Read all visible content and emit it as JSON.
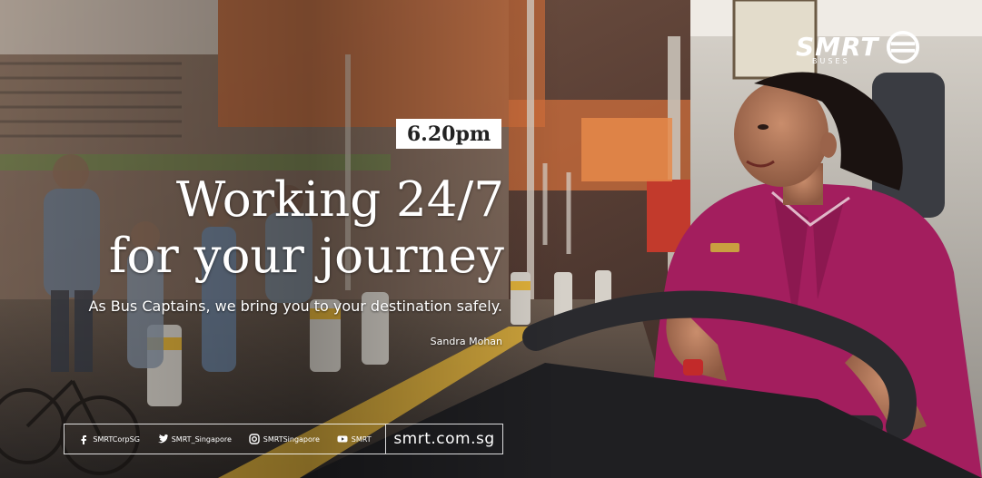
{
  "brand": {
    "logo_text": "SMRT",
    "logo_sub": "BUSES"
  },
  "time_badge": "6.20pm",
  "headline": {
    "line1": "Working 24/7",
    "line2": "for your journey"
  },
  "subline": "As Bus Captains, we bring you to your destination safely.",
  "byline": "Sandra Mohan",
  "footer": {
    "url": "smrt.com.sg",
    "social": [
      {
        "icon": "facebook-icon",
        "label": "SMRTCorpSG"
      },
      {
        "icon": "twitter-icon",
        "label": "SMRT_Singapore"
      },
      {
        "icon": "instagram-icon",
        "label": "SMRTSingapore"
      },
      {
        "icon": "youtube-icon",
        "label": "SMRT"
      }
    ]
  },
  "colors": {
    "uniform": "#a31e5e",
    "text": "#ffffff",
    "badge_bg": "#ffffff"
  }
}
